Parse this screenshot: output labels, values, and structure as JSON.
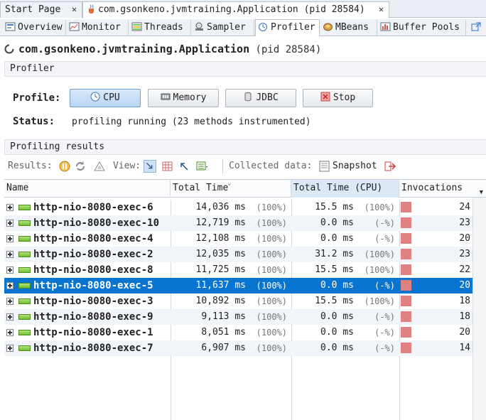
{
  "doc_tabs": [
    {
      "label": "Start Page",
      "close": "✕"
    },
    {
      "label": "com.gsonkeno.jvmtraining.Application (pid 28584)",
      "close": "✕"
    }
  ],
  "sub_tabs": [
    {
      "label": "Overview",
      "icon": "overview-icon"
    },
    {
      "label": "Monitor",
      "icon": "monitor-icon"
    },
    {
      "label": "Threads",
      "icon": "threads-icon"
    },
    {
      "label": "Sampler",
      "icon": "sampler-icon"
    },
    {
      "label": "Profiler",
      "icon": "profiler-icon"
    },
    {
      "label": "MBeans",
      "icon": "mbeans-icon"
    },
    {
      "label": "Buffer Pools",
      "icon": "buffer-pools-icon"
    }
  ],
  "app": {
    "name": "com.gsonkeno.jvmtraining.Application",
    "pid": "(pid 28584)"
  },
  "profiler_section": {
    "title": "Profiler"
  },
  "profile": {
    "label": "Profile:",
    "buttons": {
      "cpu": "CPU",
      "memory": "Memory",
      "jdbc": "JDBC",
      "stop": "Stop"
    },
    "status_label": "Status:",
    "status_value": "profiling running (23 methods instrumented)"
  },
  "results_section": {
    "title": "Profiling results"
  },
  "toolbar": {
    "results_label": "Results:",
    "view_label": "View:",
    "collected_label": "Collected data:",
    "snapshot_label": "Snapshot"
  },
  "table": {
    "columns": {
      "name": "Name",
      "total_time": "Total Time",
      "total_time_cpu": "Total Time (CPU)",
      "invocations": "Invocations"
    },
    "rows": [
      {
        "name": "http-nio-8080-exec-6",
        "total": "14,036 ms",
        "total_pct": "(100%)",
        "cpu": "15.5 ms",
        "cpu_pct": "(100%)",
        "inv": "24"
      },
      {
        "name": "http-nio-8080-exec-10",
        "total": "12,719 ms",
        "total_pct": "(100%)",
        "cpu": "0.0 ms",
        "cpu_pct": "(-%)",
        "inv": "23"
      },
      {
        "name": "http-nio-8080-exec-4",
        "total": "12,108 ms",
        "total_pct": "(100%)",
        "cpu": "0.0 ms",
        "cpu_pct": "(-%)",
        "inv": "20"
      },
      {
        "name": "http-nio-8080-exec-2",
        "total": "12,035 ms",
        "total_pct": "(100%)",
        "cpu": "31.2 ms",
        "cpu_pct": "(100%)",
        "inv": "23"
      },
      {
        "name": "http-nio-8080-exec-8",
        "total": "11,725 ms",
        "total_pct": "(100%)",
        "cpu": "15.5 ms",
        "cpu_pct": "(100%)",
        "inv": "22"
      },
      {
        "name": "http-nio-8080-exec-5",
        "total": "11,637 ms",
        "total_pct": "(100%)",
        "cpu": "0.0 ms",
        "cpu_pct": "(-%)",
        "inv": "20",
        "selected": true
      },
      {
        "name": "http-nio-8080-exec-3",
        "total": "10,892 ms",
        "total_pct": "(100%)",
        "cpu": "15.5 ms",
        "cpu_pct": "(100%)",
        "inv": "18"
      },
      {
        "name": "http-nio-8080-exec-9",
        "total": "9,113 ms",
        "total_pct": "(100%)",
        "cpu": "0.0 ms",
        "cpu_pct": "(-%)",
        "inv": "18"
      },
      {
        "name": "http-nio-8080-exec-1",
        "total": "8,051 ms",
        "total_pct": "(100%)",
        "cpu": "0.0 ms",
        "cpu_pct": "(-%)",
        "inv": "20"
      },
      {
        "name": "http-nio-8080-exec-7",
        "total": "6,907 ms",
        "total_pct": "(100%)",
        "cpu": "0.0 ms",
        "cpu_pct": "(-%)",
        "inv": "14"
      }
    ]
  },
  "colors": {
    "selection": "#0a74d1",
    "invocation_bar": "#e08181",
    "thread_icon": "#6fbf2e"
  }
}
